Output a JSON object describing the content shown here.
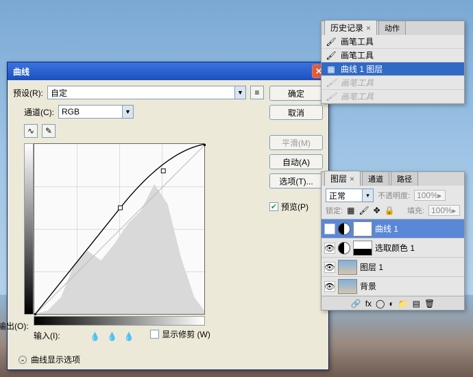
{
  "dialog": {
    "title": "曲线",
    "preset_label": "预设(R):",
    "preset_value": "自定",
    "channel_label": "通道(C):",
    "channel_value": "RGB",
    "output_label": "输出(O):",
    "input_label": "输入(I):",
    "show_clipping_label": "显示修剪 (W)",
    "display_options_label": "曲线显示选项",
    "buttons": {
      "ok": "确定",
      "cancel": "取消",
      "smooth": "平滑(M)",
      "auto": "自动(A)",
      "options": "选项(T)...",
      "preview": "预览(P)"
    }
  },
  "history": {
    "tabs": [
      "历史记录",
      "动作"
    ],
    "items": [
      {
        "label": "画笔工具",
        "selected": false,
        "dimmed": false
      },
      {
        "label": "画笔工具",
        "selected": false,
        "dimmed": false
      },
      {
        "label": "曲线 1 图层",
        "selected": true,
        "dimmed": false
      },
      {
        "label": "画笔工具",
        "selected": false,
        "dimmed": true
      },
      {
        "label": "画笔工具",
        "selected": false,
        "dimmed": true
      }
    ]
  },
  "layers": {
    "tabs": [
      "图层",
      "通道",
      "路径"
    ],
    "blend_mode": "正常",
    "opacity_label": "不透明度:",
    "opacity_value": "100%",
    "lock_label": "锁定:",
    "fill_label": "填充:",
    "fill_value": "100%",
    "rows": [
      {
        "name": "曲线 1",
        "type": "adjustment",
        "selected": true
      },
      {
        "name": "选取颜色 1",
        "type": "adjustment",
        "selected": false
      },
      {
        "name": "图层 1",
        "type": "image",
        "selected": false
      },
      {
        "name": "背景",
        "type": "image",
        "selected": false
      }
    ]
  },
  "chart_data": {
    "type": "line",
    "title": "曲线",
    "xlabel": "输入",
    "ylabel": "输出",
    "xlim": [
      0,
      255
    ],
    "ylim": [
      0,
      255
    ],
    "series": [
      {
        "name": "baseline",
        "x": [
          0,
          255
        ],
        "y": [
          0,
          255
        ]
      },
      {
        "name": "curve",
        "x": [
          0,
          64,
          128,
          192,
          255
        ],
        "y": [
          0,
          90,
          160,
          215,
          255
        ]
      }
    ],
    "control_points": [
      [
        0,
        0
      ],
      [
        128,
        160
      ],
      [
        192,
        215
      ],
      [
        255,
        255
      ]
    ]
  }
}
